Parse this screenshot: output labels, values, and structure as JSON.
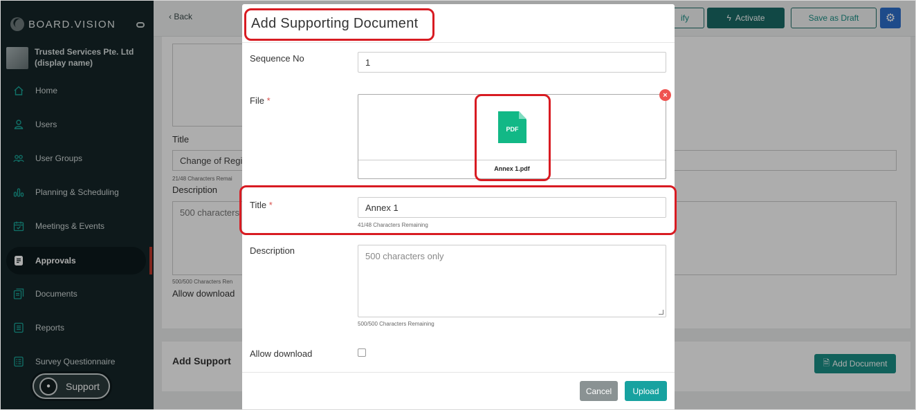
{
  "app": {
    "logo_text": "BOARD.VISION",
    "org_name": "Trusted Services Pte. Ltd (display name)"
  },
  "sidebar": {
    "items": [
      {
        "label": "Home",
        "icon": "home-icon"
      },
      {
        "label": "Users",
        "icon": "user-icon"
      },
      {
        "label": "User Groups",
        "icon": "users-icon"
      },
      {
        "label": "Planning & Scheduling",
        "icon": "bar-chart-icon"
      },
      {
        "label": "Meetings & Events",
        "icon": "calendar-check-icon"
      },
      {
        "label": "Approvals",
        "icon": "document-icon",
        "active": true
      },
      {
        "label": "Documents",
        "icon": "documents-icon"
      },
      {
        "label": "Reports",
        "icon": "report-icon"
      },
      {
        "label": "Survey Questionnaire",
        "icon": "survey-icon"
      }
    ],
    "support_label": "Support"
  },
  "topbar": {
    "back_label": "Back",
    "notify_label": "ify",
    "activate_label": "Activate",
    "save_draft_label": "Save as Draft"
  },
  "background": {
    "title_label": "Title",
    "title_value": "Change of Regis",
    "title_hint": "21/48 Characters Remai",
    "description_label": "Description",
    "description_placeholder": "500 characters",
    "description_hint": "500/500 Characters Ren",
    "allow_download_label": "Allow download",
    "supporting_section_title": "Add Support",
    "add_document_label": "Add Document"
  },
  "modal": {
    "title": "Add Supporting Document",
    "sequence_label": "Sequence No",
    "sequence_value": "1",
    "file_label": "File",
    "required_mark": "*",
    "file_type": "PDF",
    "file_name": "Annex 1.pdf",
    "title_label": "Title",
    "title_value": "Annex 1",
    "title_hint": "41/48 Characters Remaining",
    "description_label": "Description",
    "description_placeholder": "500 characters only",
    "description_hint": "500/500 Characters Remaining",
    "allow_download_label": "Allow download",
    "allow_download_checked": false,
    "cancel_label": "Cancel",
    "upload_label": "Upload"
  },
  "colors": {
    "sidebar_bg": "#152628",
    "accent": "#1a8f86",
    "highlight": "#d81b22",
    "pdf_icon": "#12b886"
  }
}
